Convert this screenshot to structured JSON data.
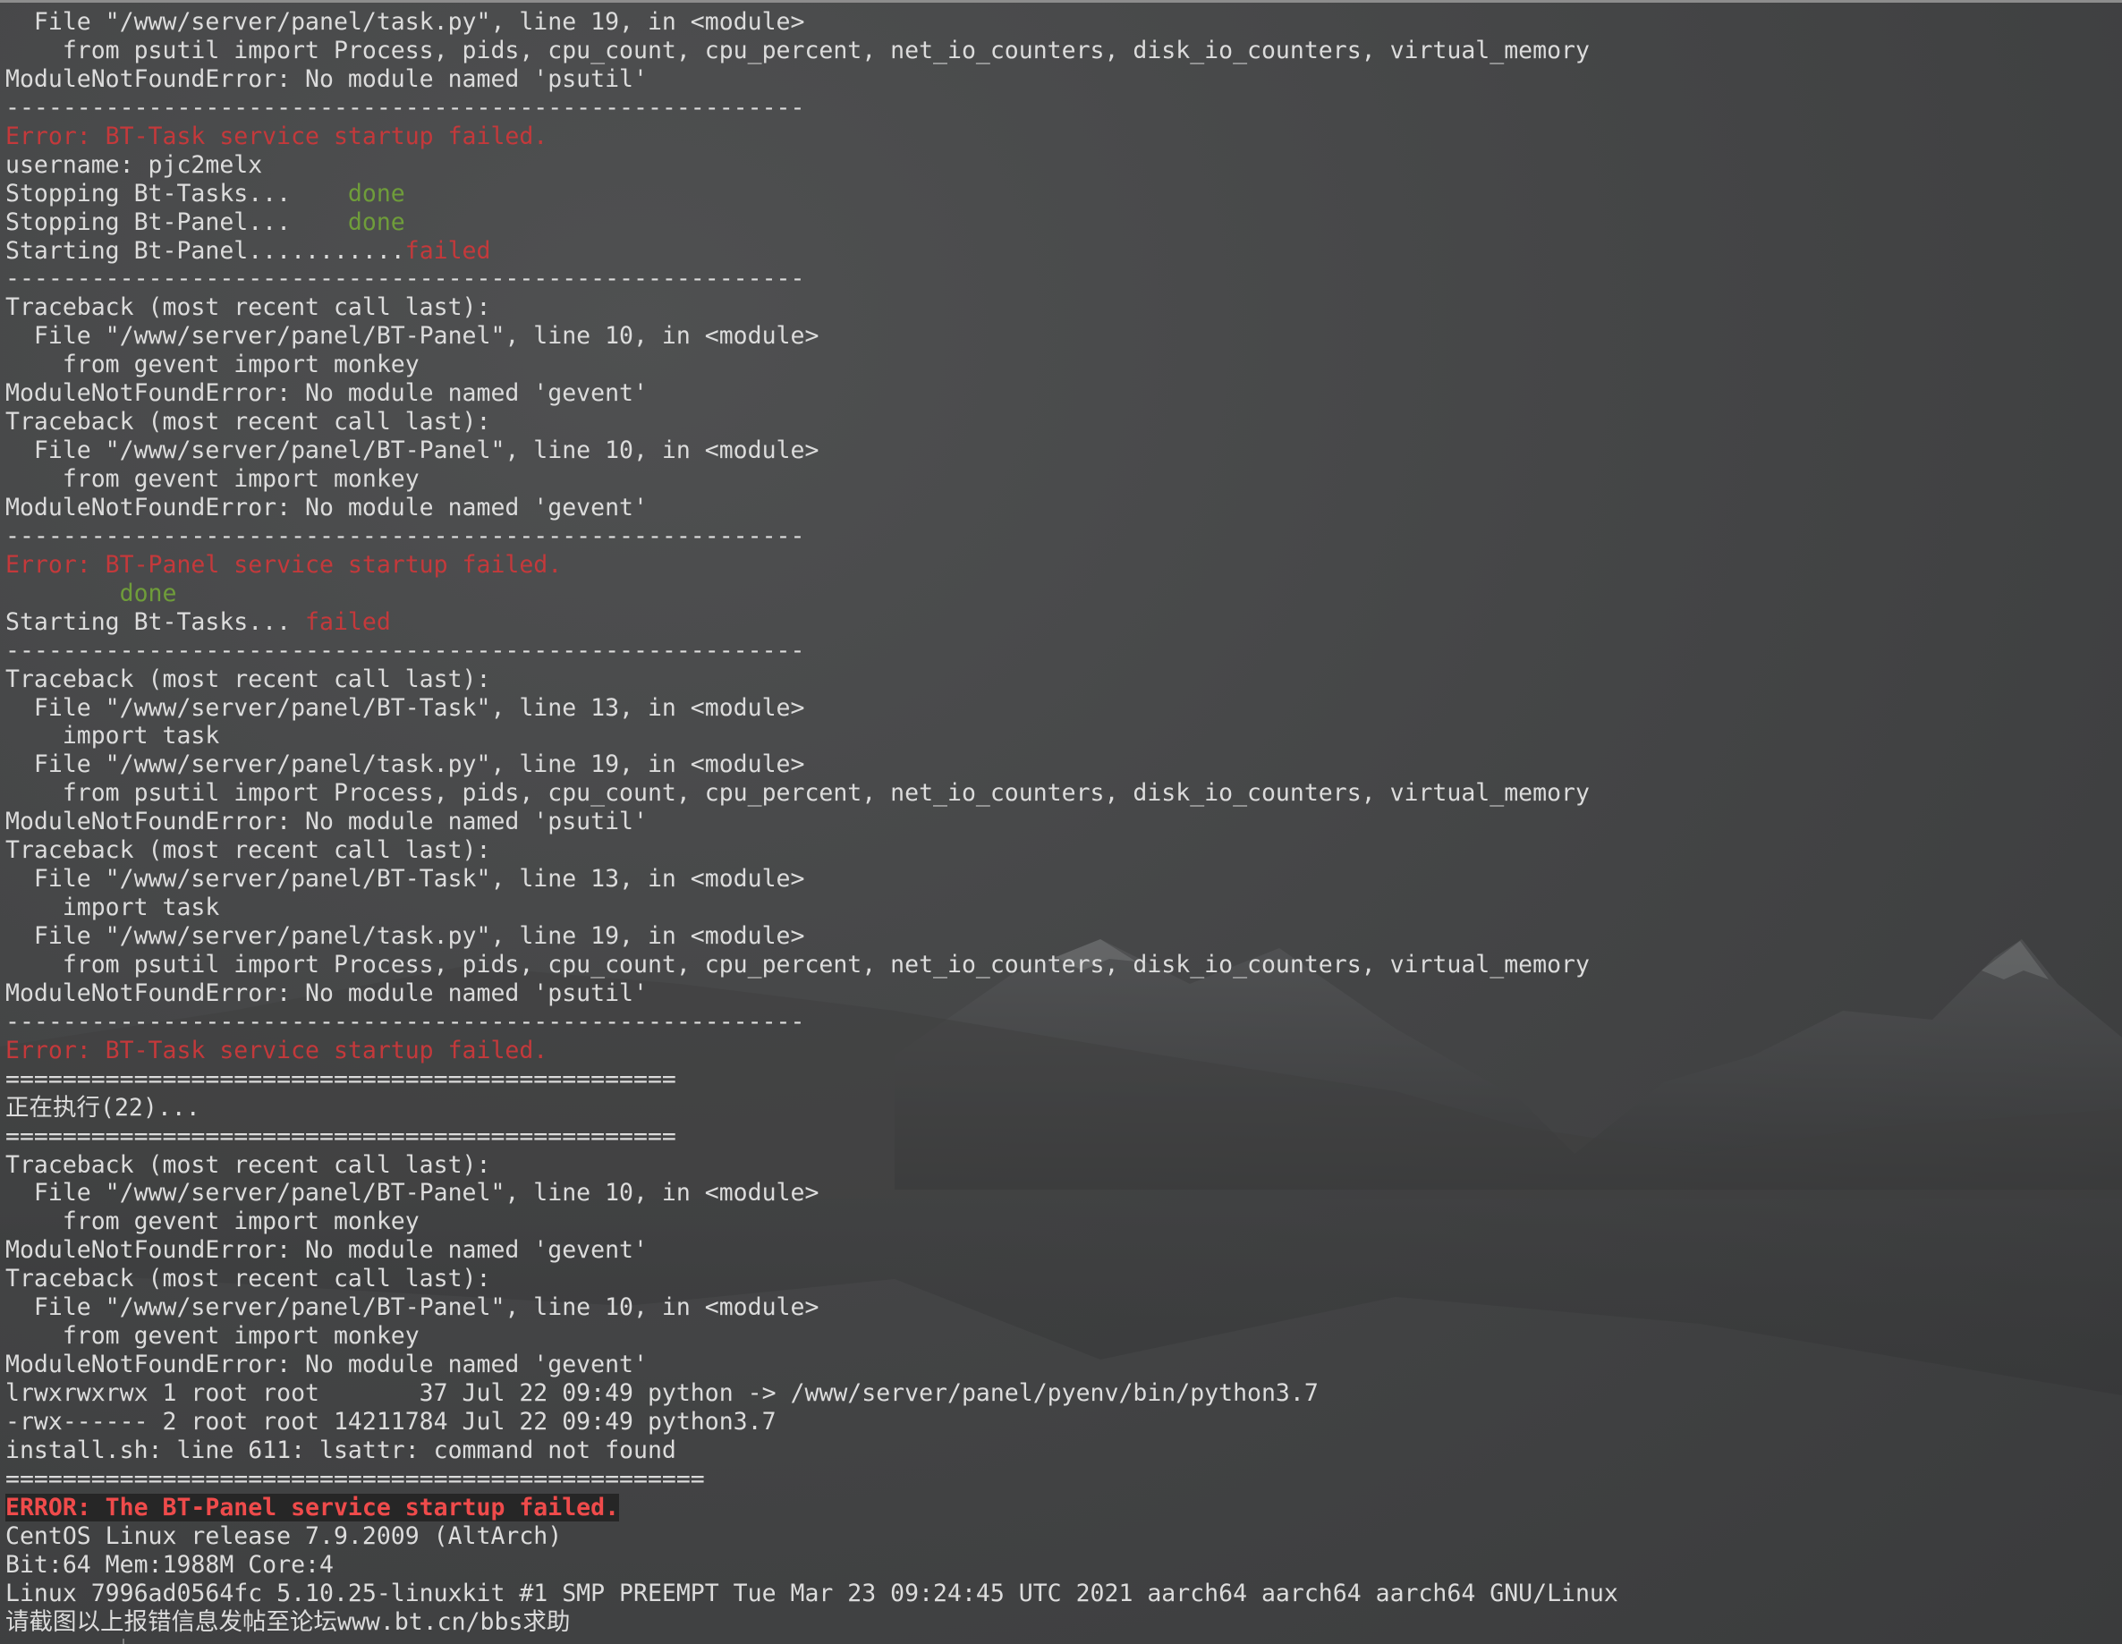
{
  "terminal": {
    "lines": [
      [
        {
          "t": "  File \"/www/server/panel/task.py\", line 19, in <module>",
          "c": "text"
        }
      ],
      [
        {
          "t": "    from psutil import Process, pids, cpu_count, cpu_percent, net_io_counters, disk_io_counters, virtual_memory",
          "c": "text"
        }
      ],
      [
        {
          "t": "ModuleNotFoundError: No module named 'psutil'",
          "c": "text"
        }
      ],
      [
        {
          "t": "--------------------------------------------------------",
          "c": "text"
        }
      ],
      [
        {
          "t": "Error: BT-Task service startup failed.",
          "c": "err"
        }
      ],
      [
        {
          "t": "username: pjc2melx",
          "c": "text"
        }
      ],
      [
        {
          "t": "Stopping Bt-Tasks...    ",
          "c": "text"
        },
        {
          "t": "done",
          "c": "ok"
        }
      ],
      [
        {
          "t": "Stopping Bt-Panel...    ",
          "c": "text"
        },
        {
          "t": "done",
          "c": "ok"
        }
      ],
      [
        {
          "t": "Starting Bt-Panel...........",
          "c": "text"
        },
        {
          "t": "failed",
          "c": "err"
        }
      ],
      [
        {
          "t": "--------------------------------------------------------",
          "c": "text"
        }
      ],
      [
        {
          "t": "Traceback (most recent call last):",
          "c": "text"
        }
      ],
      [
        {
          "t": "  File \"/www/server/panel/BT-Panel\", line 10, in <module>",
          "c": "text"
        }
      ],
      [
        {
          "t": "    from gevent import monkey",
          "c": "text"
        }
      ],
      [
        {
          "t": "ModuleNotFoundError: No module named 'gevent'",
          "c": "text"
        }
      ],
      [
        {
          "t": "Traceback (most recent call last):",
          "c": "text"
        }
      ],
      [
        {
          "t": "  File \"/www/server/panel/BT-Panel\", line 10, in <module>",
          "c": "text"
        }
      ],
      [
        {
          "t": "    from gevent import monkey",
          "c": "text"
        }
      ],
      [
        {
          "t": "ModuleNotFoundError: No module named 'gevent'",
          "c": "text"
        }
      ],
      [
        {
          "t": "--------------------------------------------------------",
          "c": "text"
        }
      ],
      [
        {
          "t": "Error: BT-Panel service startup failed.",
          "c": "err"
        }
      ],
      [
        {
          "t": "        ",
          "c": "text"
        },
        {
          "t": "done",
          "c": "ok"
        }
      ],
      [
        {
          "t": "Starting Bt-Tasks... ",
          "c": "text"
        },
        {
          "t": "failed",
          "c": "err"
        }
      ],
      [
        {
          "t": "--------------------------------------------------------",
          "c": "text"
        }
      ],
      [
        {
          "t": "Traceback (most recent call last):",
          "c": "text"
        }
      ],
      [
        {
          "t": "  File \"/www/server/panel/BT-Task\", line 13, in <module>",
          "c": "text"
        }
      ],
      [
        {
          "t": "    import task",
          "c": "text"
        }
      ],
      [
        {
          "t": "  File \"/www/server/panel/task.py\", line 19, in <module>",
          "c": "text"
        }
      ],
      [
        {
          "t": "    from psutil import Process, pids, cpu_count, cpu_percent, net_io_counters, disk_io_counters, virtual_memory",
          "c": "text"
        }
      ],
      [
        {
          "t": "ModuleNotFoundError: No module named 'psutil'",
          "c": "text"
        }
      ],
      [
        {
          "t": "Traceback (most recent call last):",
          "c": "text"
        }
      ],
      [
        {
          "t": "  File \"/www/server/panel/BT-Task\", line 13, in <module>",
          "c": "text"
        }
      ],
      [
        {
          "t": "    import task",
          "c": "text"
        }
      ],
      [
        {
          "t": "  File \"/www/server/panel/task.py\", line 19, in <module>",
          "c": "text"
        }
      ],
      [
        {
          "t": "    from psutil import Process, pids, cpu_count, cpu_percent, net_io_counters, disk_io_counters, virtual_memory",
          "c": "text"
        }
      ],
      [
        {
          "t": "ModuleNotFoundError: No module named 'psutil'",
          "c": "text"
        }
      ],
      [
        {
          "t": "--------------------------------------------------------",
          "c": "text"
        }
      ],
      [
        {
          "t": "Error: BT-Task service startup failed.",
          "c": "err"
        }
      ],
      [
        {
          "t": "===============================================",
          "c": "text"
        }
      ],
      [
        {
          "t": "正在执行(22)...",
          "c": "text"
        }
      ],
      [
        {
          "t": "===============================================",
          "c": "text"
        }
      ],
      [
        {
          "t": "Traceback (most recent call last):",
          "c": "text"
        }
      ],
      [
        {
          "t": "  File \"/www/server/panel/BT-Panel\", line 10, in <module>",
          "c": "text"
        }
      ],
      [
        {
          "t": "    from gevent import monkey",
          "c": "text"
        }
      ],
      [
        {
          "t": "ModuleNotFoundError: No module named 'gevent'",
          "c": "text"
        }
      ],
      [
        {
          "t": "Traceback (most recent call last):",
          "c": "text"
        }
      ],
      [
        {
          "t": "  File \"/www/server/panel/BT-Panel\", line 10, in <module>",
          "c": "text"
        }
      ],
      [
        {
          "t": "    from gevent import monkey",
          "c": "text"
        }
      ],
      [
        {
          "t": "ModuleNotFoundError: No module named 'gevent'",
          "c": "text"
        }
      ],
      [
        {
          "t": "lrwxrwxrwx 1 root root       37 Jul 22 09:49 python -> /www/server/panel/pyenv/bin/python3.7",
          "c": "text"
        }
      ],
      [
        {
          "t": "-rwx------ 2 root root 14211784 Jul 22 09:49 python3.7",
          "c": "text"
        }
      ],
      [
        {
          "t": "install.sh: line 611: lsattr: command not found",
          "c": "text"
        }
      ],
      [
        {
          "t": "=================================================",
          "c": "text"
        }
      ],
      [
        {
          "t": "ERROR: The BT-Panel service startup failed.",
          "c": "hl"
        }
      ],
      [
        {
          "t": "CentOS Linux release 7.9.2009 (AltArch)",
          "c": "text"
        }
      ],
      [
        {
          "t": "Bit:64 Mem:1988M Core:4",
          "c": "text"
        }
      ],
      [
        {
          "t": "Linux 7996ad0564fc 5.10.25-linuxkit #1 SMP PREEMPT Tue Mar 23 09:24:45 UTC 2021 aarch64 aarch64 aarch64 GNU/Linux",
          "c": "text"
        }
      ],
      [
        {
          "t": "请截图以上报错信息发帖至论坛www.bt.cn/bbs求助",
          "c": "text"
        }
      ]
    ]
  }
}
